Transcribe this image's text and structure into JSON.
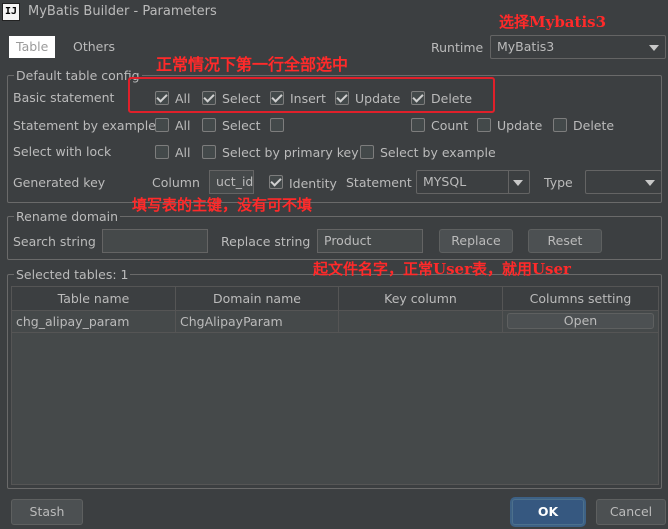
{
  "window": {
    "title": "MyBatis Builder - Parameters",
    "icon_text": "IJ"
  },
  "tabs": [
    {
      "label": "Table"
    },
    {
      "label": "Others"
    }
  ],
  "runtime": {
    "label": "Runtime",
    "value": "MyBatis3"
  },
  "default_config": {
    "legend": "Default table config",
    "basic_statement": {
      "label": "Basic statement",
      "all": "All",
      "select": "Select",
      "insert": "Insert",
      "update": "Update",
      "delete": "Delete"
    },
    "statement_by_example": {
      "label": "Statement by example",
      "all": "All",
      "select": "Select",
      "count": "Count",
      "update": "Update",
      "delete": "Delete"
    },
    "select_with_lock": {
      "label": "Select with lock",
      "all": "All",
      "by_primary_key": "Select by primary key",
      "by_example": "Select by example"
    },
    "generated_key": {
      "label": "Generated key",
      "column_label": "Column",
      "column_value": "uct_id",
      "identity": "Identity",
      "statement_label": "Statement",
      "statement_value": "MYSQL",
      "type_label": "Type",
      "type_value": ""
    }
  },
  "rename_domain": {
    "legend": "Rename domain",
    "search_label": "Search string",
    "search_value": "",
    "replace_label": "Replace string",
    "replace_value": "Product",
    "replace_button": "Replace",
    "reset_button": "Reset"
  },
  "selected_tables": {
    "legend": "Selected tables: 1",
    "columns": [
      "Table name",
      "Domain name",
      "Key column",
      "Columns setting"
    ],
    "rows": [
      {
        "table_name": "chg_alipay_param",
        "domain_name": "ChgAlipayParam",
        "key_column": "",
        "button": "Open"
      }
    ]
  },
  "footer": {
    "stash": "Stash",
    "ok": "OK",
    "cancel": "Cancel"
  },
  "annotations": {
    "runtime_note": "选择Mybatis3",
    "basic_note": "正常情况下第一行全部选中",
    "key_note": "填写表的主键，没有可不填",
    "domain_note": "起文件名字，正常User表，就用User"
  }
}
